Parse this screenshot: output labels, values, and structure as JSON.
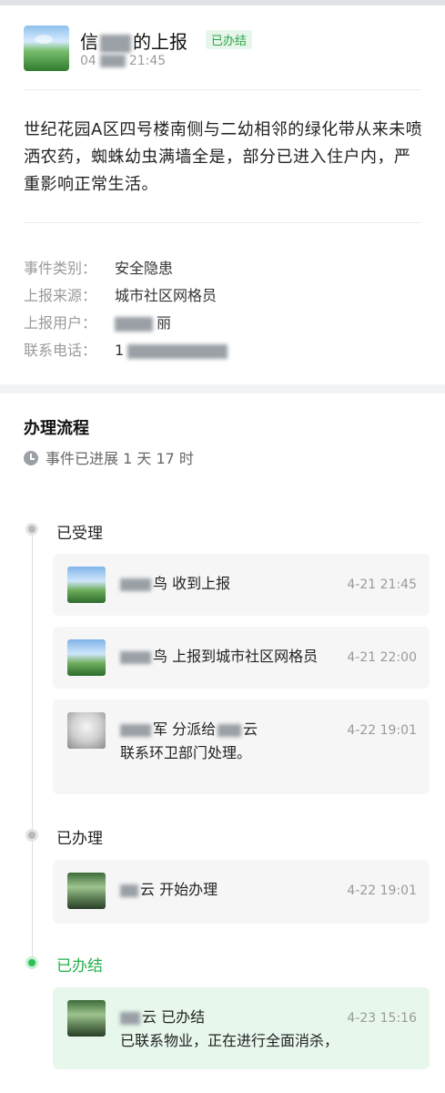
{
  "report": {
    "title_prefix": "信",
    "title_suffix": "的上报",
    "status_badge": "已办结",
    "time_prefix": "04",
    "time_suffix": "21:45",
    "description": "世纪花园A区四号楼南侧与二幼相邻的绿化带从来未喷洒农药，蜘蛛幼虫满墙全是，部分已进入住户内，严重影响正常生活。"
  },
  "info": [
    {
      "label": "事件类别：",
      "value": "安全隐患"
    },
    {
      "label": "上报来源：",
      "value": "城市社区网格员"
    },
    {
      "label": "上报用户：",
      "value": "丽"
    },
    {
      "label": "联系电话：",
      "value": "1"
    }
  ],
  "flow": {
    "title": "办理流程",
    "progress": "事件已进展 1 天 17 时",
    "stages": [
      {
        "label": "已受理",
        "entries": [
          {
            "actor_suffix": "鸟",
            "text": "收到上报",
            "time": "4-21 21:45",
            "avatar": "sky"
          },
          {
            "actor_suffix": "鸟",
            "text": "上报到城市社区网格员",
            "time": "4-21 22:00",
            "avatar": "sky"
          },
          {
            "actor_suffix": "军",
            "text": "分派给",
            "text2": "云",
            "note": "联系环卫部门处理。",
            "time": "4-22 19:01",
            "avatar": "gray"
          }
        ]
      },
      {
        "label": "已办理",
        "entries": [
          {
            "actor_suffix": "云",
            "text": "开始办理",
            "time": "4-22 19:01",
            "avatar": "forest"
          }
        ]
      },
      {
        "label": "已办结",
        "entries": [
          {
            "actor_suffix": "云",
            "text": "已办结",
            "note": "已联系物业，正在进行全面消杀，",
            "time": "4-23 15:16",
            "avatar": "forest"
          }
        ]
      }
    ]
  },
  "colors": {
    "accent_green": "#2aa44a",
    "card_bg": "#f6f6f6",
    "card_green_bg": "#e7f7ec"
  }
}
